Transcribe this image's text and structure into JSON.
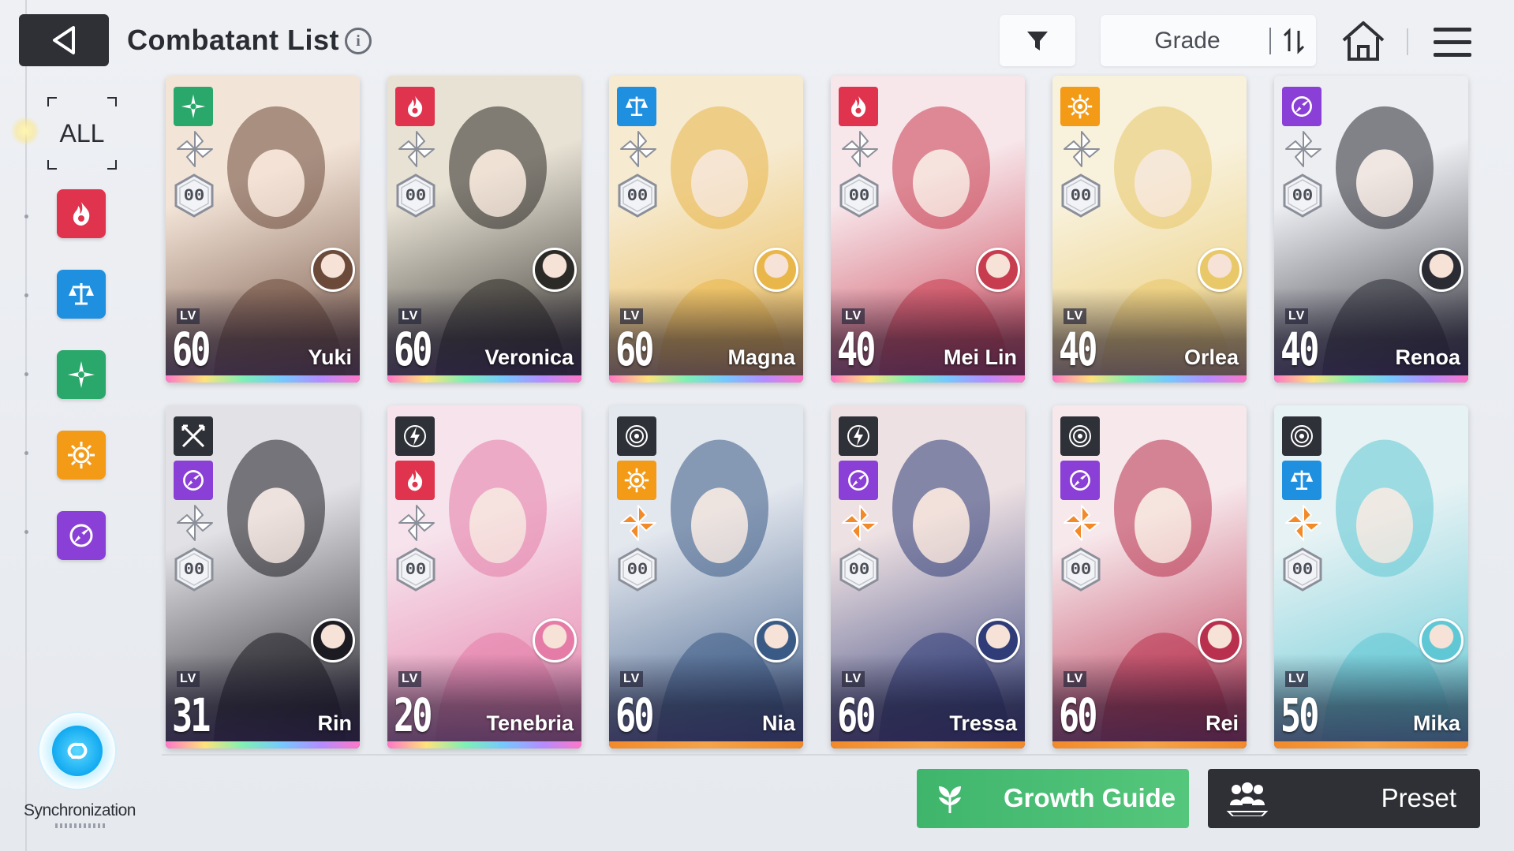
{
  "header": {
    "title": "Combatant List",
    "info_glyph": "i",
    "sort_label": "Grade"
  },
  "sidebar": {
    "all_label": "ALL",
    "elements": [
      {
        "name": "fire-element",
        "color": "#e0334d"
      },
      {
        "name": "order-element",
        "color": "#1f8fe0"
      },
      {
        "name": "wind-element",
        "color": "#2aa86b"
      },
      {
        "name": "light-element",
        "color": "#f39a16"
      },
      {
        "name": "void-element",
        "color": "#8a3fd6"
      }
    ]
  },
  "sync": {
    "label": "Synchronization"
  },
  "cards": [
    {
      "name": "Yuki",
      "level_label": "LV",
      "level": "60",
      "element": "wind",
      "role": "",
      "grade_badge": "00",
      "art": [
        "#f3e4d8",
        "#6b4a3a"
      ]
    },
    {
      "name": "Veronica",
      "level_label": "LV",
      "level": "60",
      "element": "fire",
      "role": "",
      "grade_badge": "00",
      "art": [
        "#e8e2d5",
        "#2c2a26"
      ]
    },
    {
      "name": "Magna",
      "level_label": "LV",
      "level": "60",
      "element": "order",
      "role": "",
      "grade_badge": "00",
      "art": [
        "#f6ead0",
        "#e9b64a"
      ]
    },
    {
      "name": "Mei Lin",
      "level_label": "LV",
      "level": "40",
      "element": "fire",
      "role": "",
      "grade_badge": "00",
      "art": [
        "#f7e6ea",
        "#c83c4f"
      ]
    },
    {
      "name": "Orlea",
      "level_label": "LV",
      "level": "40",
      "element": "light",
      "role": "",
      "grade_badge": "00",
      "art": [
        "#f8f1dc",
        "#e9c86a"
      ]
    },
    {
      "name": "Renoa",
      "level_label": "LV",
      "level": "40",
      "element": "void",
      "role": "",
      "grade_badge": "00",
      "art": [
        "#eceef2",
        "#2a2b33"
      ]
    },
    {
      "name": "Rin",
      "level_label": "LV",
      "level": "31",
      "element": "void",
      "role": "striker",
      "grade_badge": "00",
      "art": [
        "#e2e2e6",
        "#1c1b21"
      ]
    },
    {
      "name": "Tenebria",
      "level_label": "LV",
      "level": "20",
      "element": "fire",
      "role": "ranger",
      "grade_badge": "00",
      "art": [
        "#f6e3ec",
        "#e57ca8"
      ]
    },
    {
      "name": "Nia",
      "level_label": "LV",
      "level": "60",
      "element": "light",
      "role": "support",
      "grade_badge": "00",
      "art": [
        "#e3e7ee",
        "#3a5a86"
      ]
    },
    {
      "name": "Tressa",
      "level_label": "LV",
      "level": "60",
      "element": "void",
      "role": "ranger",
      "grade_badge": "00",
      "art": [
        "#eee1e3",
        "#2f3c77"
      ]
    },
    {
      "name": "Rei",
      "level_label": "LV",
      "level": "60",
      "element": "void",
      "role": "support",
      "grade_badge": "00",
      "art": [
        "#f7e8ec",
        "#b8304d"
      ]
    },
    {
      "name": "Mika",
      "level_label": "LV",
      "level": "50",
      "element": "order",
      "role": "support",
      "grade_badge": "00",
      "art": [
        "#e6f2f4",
        "#5fc8d4"
      ]
    }
  ],
  "footer": {
    "growth_label": "Growth Guide",
    "preset_label": "Preset"
  },
  "colors": {
    "fire": "#e0334d",
    "order": "#1f8fe0",
    "wind": "#2aa86b",
    "light": "#f39a16",
    "void": "#8a3fd6",
    "growth": "#46b970",
    "dark": "#2e3036"
  }
}
